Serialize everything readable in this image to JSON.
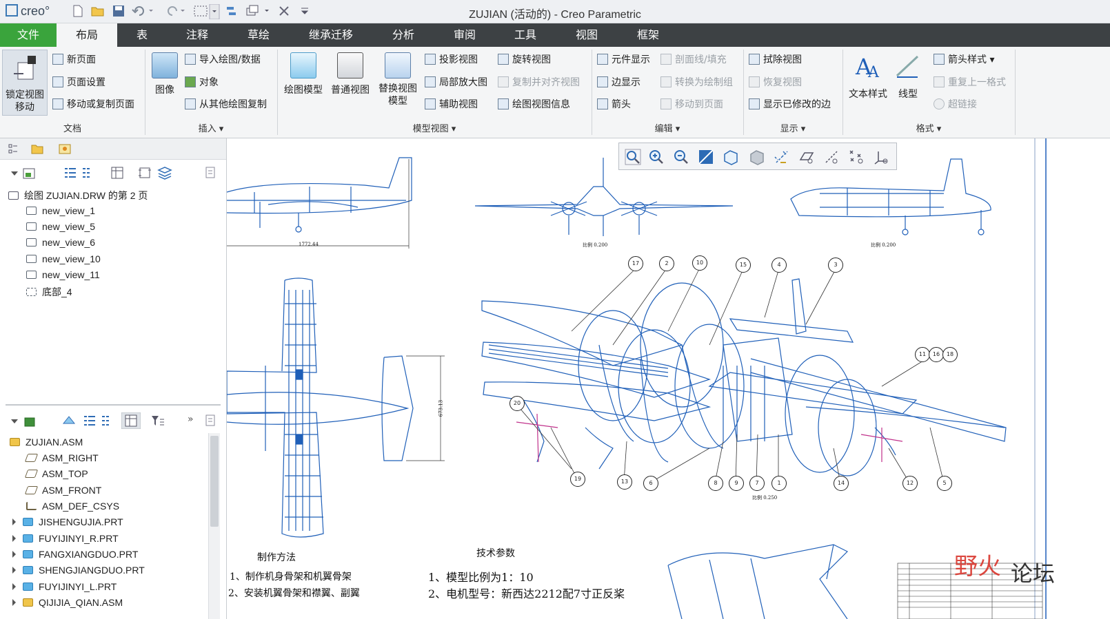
{
  "titlebar": {
    "logo": "creo",
    "title": "ZUJIAN (活动的) - Creo Parametric"
  },
  "tabs": [
    {
      "label": "文件"
    },
    {
      "label": "布局"
    },
    {
      "label": "表"
    },
    {
      "label": "注释"
    },
    {
      "label": "草绘"
    },
    {
      "label": "继承迁移"
    },
    {
      "label": "分析"
    },
    {
      "label": "审阅"
    },
    {
      "label": "工具"
    },
    {
      "label": "视图"
    },
    {
      "label": "框架"
    }
  ],
  "ribbon": {
    "document": {
      "group_label": "文档",
      "lock_view": "锁定视图\n移动",
      "new_page": "新页面",
      "page_setup": "页面设置",
      "move_copy_page": "移动或复制页面"
    },
    "insert": {
      "group_label": "插入",
      "image": "图像",
      "import_drawing": "导入绘图/数据",
      "object": "对象",
      "copy_from_other": "从其他绘图复制"
    },
    "model_views": {
      "group_label": "模型视图",
      "drawing_model": "绘图模型",
      "general_view": "普通视图",
      "replace_view_model": "替换视图\n模型",
      "projection_view": "投影视图",
      "detailed_view": "局部放大图",
      "auxiliary_view": "辅助视图",
      "revolved_view": "旋转视图",
      "copy_align_view": "复制并对齐视图",
      "drawing_view_info": "绘图视图信息"
    },
    "edit": {
      "group_label": "编辑",
      "component_display": "元件显示",
      "edge_display": "边显示",
      "arrow": "箭头",
      "section_fill": "剖面线/填充",
      "convert_to_draw_group": "转换为绘制组",
      "move_to_page": "移动到页面"
    },
    "display": {
      "group_label": "显示",
      "erase_view": "拭除视图",
      "restore_view": "恢复视图",
      "show_modified_edges": "显示已修改的边"
    },
    "format": {
      "group_label": "格式",
      "text_style": "文本样式",
      "line_style": "线型",
      "arrow_style": "箭头样式",
      "repeat_last_format": "重复上一格式",
      "hyperlink": "超链接"
    }
  },
  "drawing_tree": {
    "root": "绘图 ZUJIAN.DRW 的第 2 页",
    "items": [
      "new_view_1",
      "new_view_5",
      "new_view_6",
      "new_view_10",
      "new_view_11",
      "底部_4"
    ]
  },
  "model_tree": {
    "root": "ZUJIAN.ASM",
    "datums": [
      "ASM_RIGHT",
      "ASM_TOP",
      "ASM_FRONT",
      "ASM_DEF_CSYS"
    ],
    "parts": [
      "JISHENGUJIA.PRT",
      "FUYIJINYI_R.PRT",
      "FANGXIANGDUO.PRT",
      "SHENGJIANGDUO.PRT",
      "FUYIJINYI_L.PRT",
      "QIJIJIA_QIAN.ASM"
    ]
  },
  "drawing": {
    "dim_length": "1772.44",
    "dim_height": "673.13",
    "scale_1": "比例 0.200",
    "scale_2": "比例 0.200",
    "scale_3": "比例 0.250",
    "method_title": "制作方法",
    "method_lines": [
      "1、制作机身骨架和机翼骨架",
      "2、安装机翼骨架和襟翼、副翼"
    ],
    "tech_title": "技术参数",
    "tech_lines": [
      "1、模型比例为1：10",
      "2、电机型号：新西达2212配7寸正反桨"
    ],
    "balloons": [
      "17",
      "2",
      "10",
      "15",
      "4",
      "3",
      "11",
      "16",
      "18",
      "20",
      "19",
      "13",
      "6",
      "8",
      "9",
      "7",
      "1",
      "14",
      "12",
      "5"
    ]
  },
  "watermark": {
    "main": "野火",
    "sub": "论坛"
  },
  "colors": {
    "file_tab": "#3aa43c",
    "tab_bar": "#3d4144",
    "drawing_line": "#1f5fb8"
  }
}
